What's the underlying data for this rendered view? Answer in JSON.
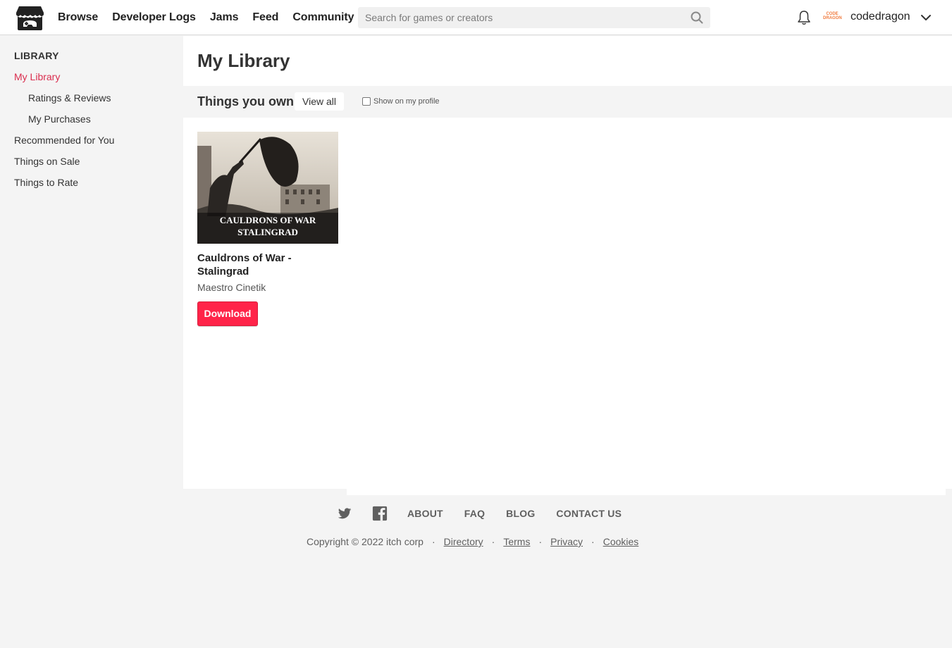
{
  "header": {
    "nav": [
      "Browse",
      "Developer Logs",
      "Jams",
      "Feed",
      "Community"
    ],
    "search_placeholder": "Search for games or creators",
    "avatar_text": "CODE DRAGON",
    "username": "codedragon"
  },
  "sidebar": {
    "title": "LIBRARY",
    "items": [
      {
        "label": "My Library"
      },
      {
        "label": "Ratings & Reviews"
      },
      {
        "label": "My Purchases"
      },
      {
        "label": "Recommended for You"
      },
      {
        "label": "Things on Sale"
      },
      {
        "label": "Things to Rate"
      }
    ]
  },
  "main": {
    "title": "My Library",
    "shelf": {
      "title": "Things you own",
      "view_all": "View all",
      "show_on_profile": "Show on my profile",
      "show_on_profile_checked": false
    },
    "game": {
      "cover_caption_line1": "CAULDRONS OF WAR",
      "cover_caption_line2": "STALINGRAD",
      "title": "Cauldrons of War - Stalingrad",
      "author": "Maestro Cinetik",
      "button": "Download"
    }
  },
  "footer": {
    "links": [
      "ABOUT",
      "FAQ",
      "BLOG",
      "CONTACT US"
    ],
    "copyright": "Copyright © 2022 itch corp",
    "separator": "·",
    "legal": [
      "Directory",
      "Terms",
      "Privacy",
      "Cookies"
    ]
  },
  "colors": {
    "accent": "#da2d4e",
    "button": "#ff2449",
    "background": "#f4f4f4"
  },
  "icons": [
    "itch-logo-icon",
    "search-icon",
    "bell-icon",
    "chevron-down-icon",
    "twitter-icon",
    "facebook-icon"
  ]
}
